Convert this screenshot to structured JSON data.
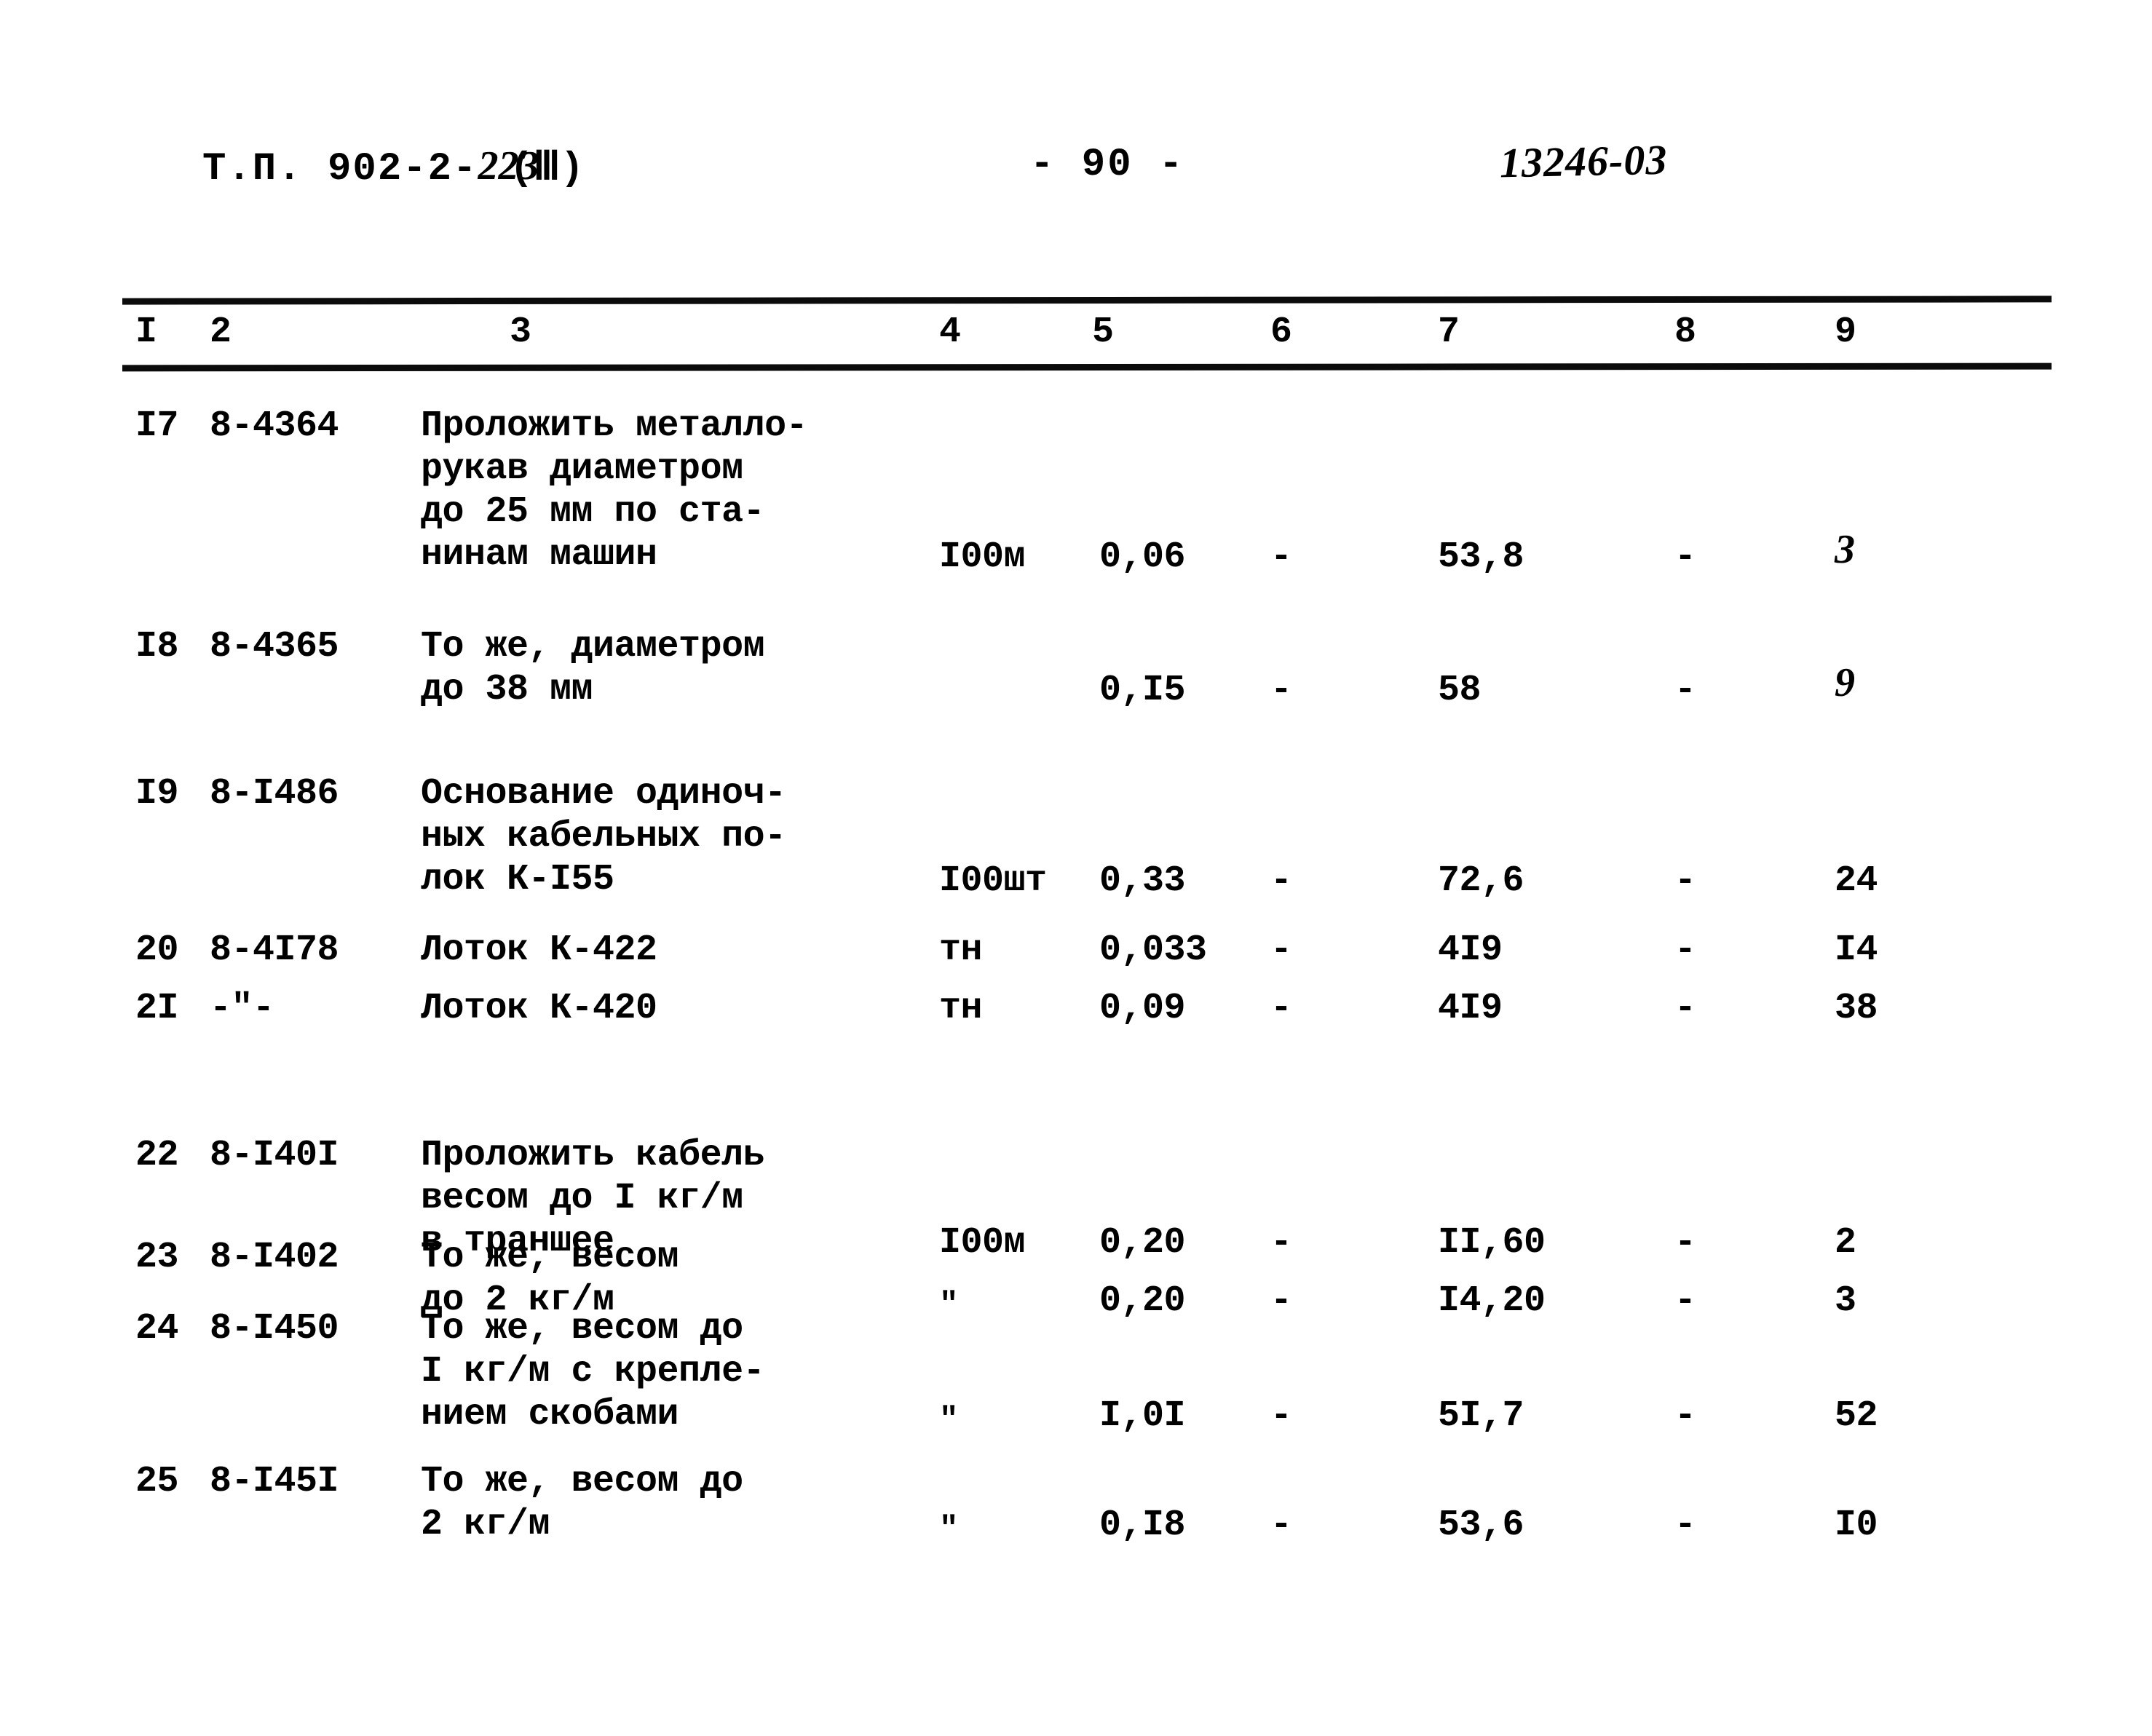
{
  "header": {
    "doc_prefix": "Т.П. 902-2-",
    "doc_series": "223",
    "part": "(Ⅲ)",
    "page_number": "- 90 -",
    "archive_code": "13246-03"
  },
  "table": {
    "column_headers": [
      "I",
      "2",
      "3",
      "4",
      "5",
      "6",
      "7",
      "8",
      "9"
    ],
    "rows": [
      {
        "num": "I7",
        "code": "8-4364",
        "desc": "Проложить металло-\nрукав диаметром\nдо 25 мм по ста-\nнинам машин",
        "unit": "I00м",
        "qty": "0,06",
        "col6": "-",
        "col7": "53,8",
        "col8": "-",
        "col9": "3",
        "col9_hand": true
      },
      {
        "num": "I8",
        "code": "8-4365",
        "desc": "То же, диаметром\nдо 38 мм",
        "unit": "",
        "qty": "0,I5",
        "col6": "-",
        "col7": "58",
        "col8": "-",
        "col9": "9",
        "col9_hand": true
      },
      {
        "num": "I9",
        "code": "8-I486",
        "desc": "Основание одиноч-\nных кабельных по-\nлок К-I55",
        "unit": "I00шт",
        "qty": "0,33",
        "col6": "-",
        "col7": "72,6",
        "col8": "-",
        "col9": "24",
        "col9_hand": false
      },
      {
        "num": "20",
        "code": "8-4I78",
        "desc": "Лоток К-422",
        "unit": "тн",
        "qty": "0,033",
        "col6": "-",
        "col7": "4I9",
        "col8": "-",
        "col9": "I4",
        "col9_hand": false
      },
      {
        "num": "2I",
        "code": "-\"-",
        "desc": "Лоток К-420",
        "unit": "тн",
        "qty": "0,09",
        "col6": "-",
        "col7": "4I9",
        "col8": "-",
        "col9": "38",
        "col9_hand": false
      },
      {
        "num": "22",
        "code": "8-I40I",
        "desc": "Проложить кабель\nвесом до I кг/м\nв траншее",
        "unit": "I00м",
        "qty": "0,20",
        "col6": "-",
        "col7": "II,60",
        "col8": "-",
        "col9": "2",
        "col9_hand": false
      },
      {
        "num": "23",
        "code": "8-I402",
        "desc": "То же, весом\nдо 2 кг/м",
        "unit": "\"",
        "qty": "0,20",
        "col6": "-",
        "col7": "I4,20",
        "col8": "-",
        "col9": "3",
        "col9_hand": false
      },
      {
        "num": "24",
        "code": "8-I450",
        "desc": "То же, весом до\nI кг/м с крепле-\nнием скобами",
        "unit": "\"",
        "qty": "I,0I",
        "col6": "-",
        "col7": "5I,7",
        "col8": "-",
        "col9": "52",
        "col9_hand": false
      },
      {
        "num": "25",
        "code": "8-I45I",
        "desc": "То же, весом до\n2 кг/м",
        "unit": "\"",
        "qty": "0,I8",
        "col6": "-",
        "col7": "53,6",
        "col8": "-",
        "col9": "I0",
        "col9_hand": false
      }
    ]
  },
  "layout": {
    "column_header_x": [
      186,
      288,
      700,
      1290,
      1500,
      1745,
      1975,
      2300,
      2520
    ],
    "row_tops": [
      0,
      303,
      505,
      720,
      800,
      1002,
      1142,
      1240,
      1450
    ],
    "row_value_offsets": [
      180,
      60,
      120,
      0,
      0,
      120,
      60,
      120,
      60
    ]
  }
}
